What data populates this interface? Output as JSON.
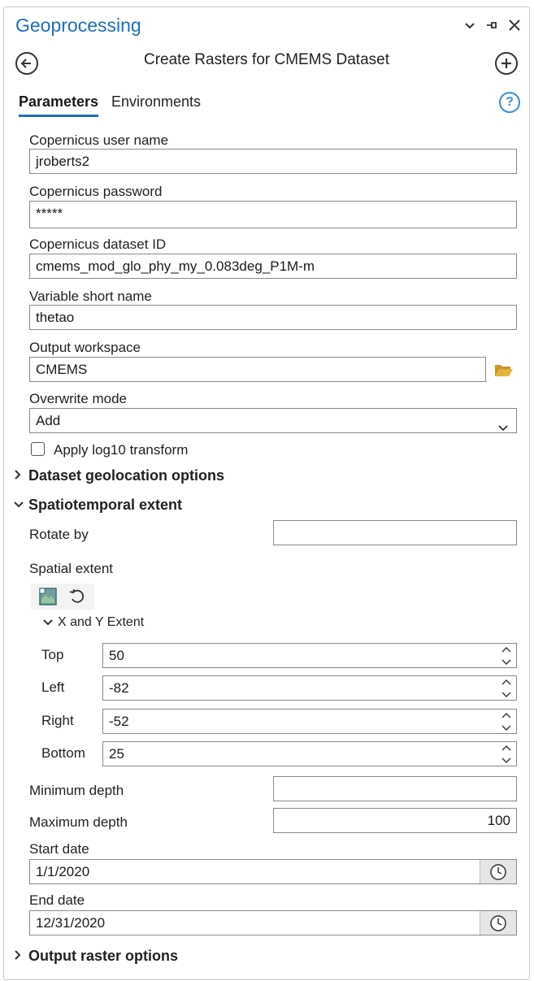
{
  "header": {
    "title": "Geoprocessing",
    "tool_title": "Create Rasters for CMEMS Dataset"
  },
  "tabs": [
    {
      "label": "Parameters",
      "active": true
    },
    {
      "label": "Environments",
      "active": false
    }
  ],
  "fields": {
    "username": {
      "label": "Copernicus user name",
      "value": "jroberts2"
    },
    "password": {
      "label": "Copernicus password",
      "value": "*****"
    },
    "dataset_id": {
      "label": "Copernicus dataset ID",
      "value": "cmems_mod_glo_phy_my_0.083deg_P1M-m"
    },
    "variable": {
      "label": "Variable short name",
      "value": "thetao"
    },
    "workspace": {
      "label": "Output workspace",
      "value": "CMEMS"
    },
    "overwrite": {
      "label": "Overwrite mode",
      "value": "Add"
    },
    "log10": {
      "label": "Apply log10 transform",
      "checked": false
    }
  },
  "sections": {
    "geolocation": {
      "label": "Dataset geolocation options",
      "expanded": false
    },
    "spatiotemporal": {
      "label": "Spatiotemporal extent",
      "expanded": true
    },
    "output_raster": {
      "label": "Output raster options",
      "expanded": false
    }
  },
  "spatiotemporal": {
    "rotate_by": {
      "label": "Rotate by",
      "value": ""
    },
    "spatial_extent_label": "Spatial extent",
    "xy_extent_label": "X and Y Extent",
    "top": {
      "label": "Top",
      "value": "50"
    },
    "left": {
      "label": "Left",
      "value": "-82"
    },
    "right": {
      "label": "Right",
      "value": "-52"
    },
    "bottom": {
      "label": "Bottom",
      "value": "25"
    },
    "min_depth": {
      "label": "Minimum depth",
      "value": ""
    },
    "max_depth": {
      "label": "Maximum depth",
      "value": "100"
    },
    "start_date": {
      "label": "Start date",
      "value": "1/1/2020"
    },
    "end_date": {
      "label": "End date",
      "value": "12/31/2020"
    }
  },
  "icons": {
    "back": "back-arrow-icon",
    "add": "plus-circle-icon",
    "help": "help-icon",
    "folder": "folder-icon",
    "clock": "clock-icon",
    "map": "map-extent-icon",
    "reset": "reset-icon"
  },
  "colors": {
    "accent": "#1f6dbf",
    "folder": "#e2b33a",
    "help": "#3a8fd6"
  }
}
